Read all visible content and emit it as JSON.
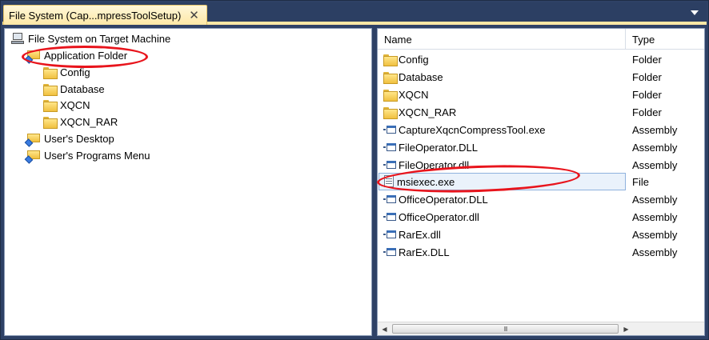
{
  "tab": {
    "label": "File System (Cap...mpressToolSetup)",
    "close_glyph": "✕"
  },
  "tree": {
    "root": "File System on Target Machine",
    "items": [
      {
        "label": "Application Folder",
        "icon": "special-folder-icon"
      },
      {
        "label": "Config",
        "icon": "folder-icon"
      },
      {
        "label": "Database",
        "icon": "folder-icon"
      },
      {
        "label": "XQCN",
        "icon": "folder-icon"
      },
      {
        "label": "XQCN_RAR",
        "icon": "folder-icon"
      },
      {
        "label": "User's Desktop",
        "icon": "special-folder-icon"
      },
      {
        "label": "User's Programs Menu",
        "icon": "special-folder-icon"
      }
    ]
  },
  "list": {
    "columns": {
      "name": "Name",
      "type": "Type"
    },
    "rows": [
      {
        "name": "Config",
        "type": "Folder",
        "icon": "folder-icon"
      },
      {
        "name": "Database",
        "type": "Folder",
        "icon": "folder-icon"
      },
      {
        "name": "XQCN",
        "type": "Folder",
        "icon": "folder-icon"
      },
      {
        "name": "XQCN_RAR",
        "type": "Folder",
        "icon": "folder-icon"
      },
      {
        "name": "CaptureXqcnCompressTool.exe",
        "type": "Assembly",
        "icon": "assembly-icon"
      },
      {
        "name": "FileOperator.DLL",
        "type": "Assembly",
        "icon": "assembly-icon"
      },
      {
        "name": "FileOperator.dll",
        "type": "Assembly",
        "icon": "assembly-icon"
      },
      {
        "name": "msiexec.exe",
        "type": "File",
        "icon": "file-icon",
        "selected": true
      },
      {
        "name": "OfficeOperator.DLL",
        "type": "Assembly",
        "icon": "assembly-icon"
      },
      {
        "name": "OfficeOperator.dll",
        "type": "Assembly",
        "icon": "assembly-icon"
      },
      {
        "name": "RarEx.dll",
        "type": "Assembly",
        "icon": "assembly-icon"
      },
      {
        "name": "RarEx.DLL",
        "type": "Assembly",
        "icon": "assembly-icon"
      }
    ]
  },
  "scrollbar": {
    "left_glyph": "◀",
    "right_glyph": "▶",
    "grip_glyph": "III"
  },
  "colors": {
    "annotation": "#e8141c",
    "tab_active": "#fde8a6",
    "chrome": "#2e4166",
    "selection": "#eaf2fb"
  }
}
